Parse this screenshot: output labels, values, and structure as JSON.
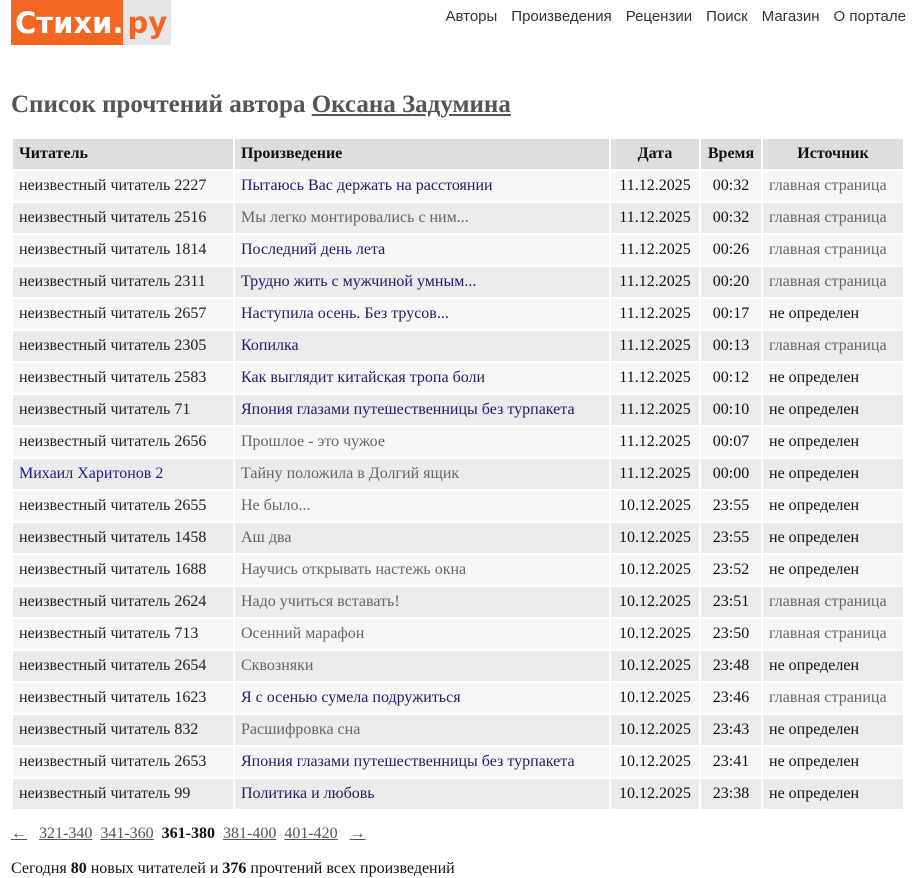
{
  "logo": {
    "main": "Стихи",
    "dot": ".",
    "ru": "ру"
  },
  "nav": [
    "Авторы",
    "Произведения",
    "Рецензии",
    "Поиск",
    "Магазин",
    "О портале"
  ],
  "heading": {
    "prefix": "Список прочтений автора ",
    "author": "Оксана Задумина"
  },
  "table": {
    "headers": [
      "Читатель",
      "Произведение",
      "Дата",
      "Время",
      "Источник"
    ],
    "rows": [
      {
        "reader": "неизвестный читатель 2227",
        "reader_link": false,
        "work": "Пытаюсь Вас держать на расстоянии",
        "work_style": "link",
        "date": "11.12.2025",
        "time": "00:32",
        "source": "главная страница"
      },
      {
        "reader": "неизвестный читатель 2516",
        "reader_link": false,
        "work": "Мы легко монтировались с ним...",
        "work_style": "grey",
        "date": "11.12.2025",
        "time": "00:32",
        "source": "главная страница"
      },
      {
        "reader": "неизвестный читатель 1814",
        "reader_link": false,
        "work": "Последний день лета",
        "work_style": "link",
        "date": "11.12.2025",
        "time": "00:26",
        "source": "главная страница"
      },
      {
        "reader": "неизвестный читатель 2311",
        "reader_link": false,
        "work": "Трудно жить с мужчиной умным...",
        "work_style": "link",
        "date": "11.12.2025",
        "time": "00:20",
        "source": "главная страница"
      },
      {
        "reader": "неизвестный читатель 2657",
        "reader_link": false,
        "work": "Наступила осень. Без трусов...",
        "work_style": "link",
        "date": "11.12.2025",
        "time": "00:17",
        "source": "не определен"
      },
      {
        "reader": "неизвестный читатель 2305",
        "reader_link": false,
        "work": "Копилка",
        "work_style": "link",
        "date": "11.12.2025",
        "time": "00:13",
        "source": "главная страница"
      },
      {
        "reader": "неизвестный читатель 2583",
        "reader_link": false,
        "work": "Как выглядит китайская тропа боли",
        "work_style": "link",
        "date": "11.12.2025",
        "time": "00:12",
        "source": "не определен"
      },
      {
        "reader": "неизвестный читатель 71",
        "reader_link": false,
        "work": "Япония глазами путешественницы без турпакета",
        "work_style": "link",
        "date": "11.12.2025",
        "time": "00:10",
        "source": "не определен"
      },
      {
        "reader": "неизвестный читатель 2656",
        "reader_link": false,
        "work": "Прошлое - это чужое",
        "work_style": "grey",
        "date": "11.12.2025",
        "time": "00:07",
        "source": "не определен"
      },
      {
        "reader": "Михаил Харитонов 2",
        "reader_link": true,
        "work": "Тайну положила в Долгий ящик",
        "work_style": "grey",
        "date": "11.12.2025",
        "time": "00:00",
        "source": "не определен"
      },
      {
        "reader": "неизвестный читатель 2655",
        "reader_link": false,
        "work": "Не было...",
        "work_style": "grey",
        "date": "10.12.2025",
        "time": "23:55",
        "source": "не определен"
      },
      {
        "reader": "неизвестный читатель 1458",
        "reader_link": false,
        "work": "Аш два",
        "work_style": "grey",
        "date": "10.12.2025",
        "time": "23:55",
        "source": "не определен"
      },
      {
        "reader": "неизвестный читатель 1688",
        "reader_link": false,
        "work": "Научись открывать настежь окна",
        "work_style": "grey",
        "date": "10.12.2025",
        "time": "23:52",
        "source": "не определен"
      },
      {
        "reader": "неизвестный читатель 2624",
        "reader_link": false,
        "work": "Надо учиться вставать!",
        "work_style": "grey",
        "date": "10.12.2025",
        "time": "23:51",
        "source": "главная страница"
      },
      {
        "reader": "неизвестный читатель 713",
        "reader_link": false,
        "work": "Осенний марафон",
        "work_style": "grey",
        "date": "10.12.2025",
        "time": "23:50",
        "source": "главная страница"
      },
      {
        "reader": "неизвестный читатель 2654",
        "reader_link": false,
        "work": "Сквозняки",
        "work_style": "grey",
        "date": "10.12.2025",
        "time": "23:48",
        "source": "не определен"
      },
      {
        "reader": "неизвестный читатель 1623",
        "reader_link": false,
        "work": "Я с осенью сумела подружиться",
        "work_style": "link",
        "date": "10.12.2025",
        "time": "23:46",
        "source": "главная страница"
      },
      {
        "reader": "неизвестный читатель 832",
        "reader_link": false,
        "work": "Расшифровка сна",
        "work_style": "grey",
        "date": "10.12.2025",
        "time": "23:43",
        "source": "не определен"
      },
      {
        "reader": "неизвестный читатель 2653",
        "reader_link": false,
        "work": "Япония глазами путешественницы без турпакета",
        "work_style": "link",
        "date": "10.12.2025",
        "time": "23:41",
        "source": "не определен"
      },
      {
        "reader": "неизвестный читатель 99",
        "reader_link": false,
        "work": "Политика и любовь",
        "work_style": "link",
        "date": "10.12.2025",
        "time": "23:38",
        "source": "не определен"
      }
    ]
  },
  "pager": {
    "prev": "←",
    "next": "→",
    "pages": [
      {
        "label": "321-340",
        "current": false
      },
      {
        "label": "341-360",
        "current": false
      },
      {
        "label": "361-380",
        "current": true
      },
      {
        "label": "381-400",
        "current": false
      },
      {
        "label": "401-420",
        "current": false
      }
    ]
  },
  "stats": {
    "t1": "Сегодня ",
    "readers": "80",
    "t2": " новых читателей и ",
    "reads": "376",
    "t3": " прочтений всех произведений"
  },
  "colors": {
    "brand": "#f26522"
  }
}
